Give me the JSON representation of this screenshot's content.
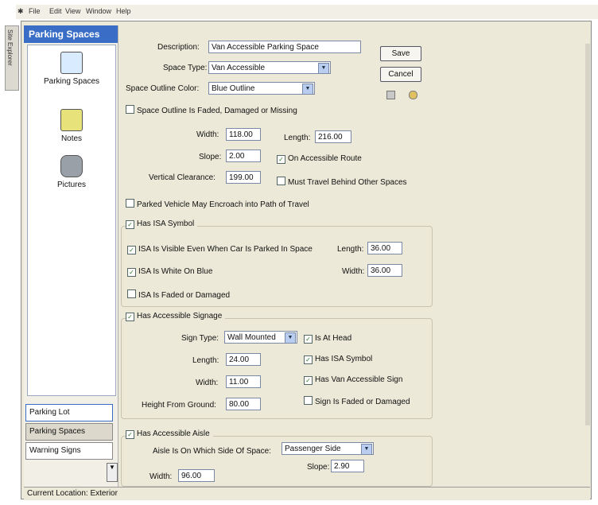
{
  "menubar": {
    "items": [
      "File",
      "Edit",
      "View",
      "Window",
      "Help"
    ]
  },
  "side_tab": "Site Explorer",
  "left": {
    "header": "Parking Spaces",
    "nav": [
      {
        "label": "Parking Spaces",
        "icon": "document-edit-icon"
      },
      {
        "label": "Notes",
        "icon": "notes-icon"
      },
      {
        "label": "Pictures",
        "icon": "camera-icon"
      }
    ],
    "bottom_nav": [
      "Parking Lot",
      "Parking Spaces",
      "Warning Signs"
    ]
  },
  "status": "Current Location: Exterior",
  "form": {
    "description_label": "Description:",
    "description_value": "Van Accessible Parking Space",
    "space_type_label": "Space Type:",
    "space_type_value": "Van Accessible",
    "outline_color_label": "Space Outline Color:",
    "outline_color_value": "Blue Outline",
    "outline_faded": "Space Outline Is Faded, Damaged or Missing",
    "width_label": "Width:",
    "width_value": "118.00",
    "length_label": "Length:",
    "length_value": "216.00",
    "slope_label": "Slope:",
    "slope_value": "2.00",
    "on_route": "On Accessible Route",
    "clearance_label": "Vertical Clearance:",
    "clearance_value": "199.00",
    "travel_behind": "Must Travel Behind Other Spaces",
    "encroach": "Parked Vehicle May Encroach into Path of Travel",
    "save": "Save",
    "cancel": "Cancel"
  },
  "isa": {
    "has_isa": "Has ISA Symbol",
    "visible": "ISA Is Visible Even When Car Is Parked In Space",
    "length_label": "Length:",
    "length_value": "36.00",
    "white_blue": "ISA Is White On Blue",
    "width_label": "Width:",
    "width_value": "36.00",
    "faded": "ISA Is Faded or Damaged"
  },
  "signage": {
    "has_signage": "Has Accessible Signage",
    "sign_type_label": "Sign Type:",
    "sign_type_value": "Wall Mounted",
    "at_head": "Is At Head",
    "length_label": "Length:",
    "length_value": "24.00",
    "has_isa": "Has ISA Symbol",
    "width_label": "Width:",
    "width_value": "11.00",
    "van_sign": "Has Van Accessible Sign",
    "height_label": "Height From Ground:",
    "height_value": "80.00",
    "sign_faded": "Sign Is Faded or Damaged"
  },
  "aisle": {
    "has_aisle": "Has Accessible Aisle",
    "side_label": "Aisle Is On Which Side Of Space:",
    "side_value": "Passenger Side",
    "width_label": "Width:",
    "width_value": "96.00",
    "slope_label": "Slope:",
    "slope_value": "2.90"
  },
  "checked": {
    "outline_faded": false,
    "on_route": true,
    "travel_behind": false,
    "encroach": false,
    "has_isa": true,
    "isa_visible": true,
    "isa_white_blue": true,
    "isa_faded": false,
    "has_signage": true,
    "at_head": true,
    "sign_has_isa": true,
    "van_sign": true,
    "sign_faded": false,
    "has_aisle": true
  },
  "colors": {
    "header_blue": "#3a6ec6",
    "panel": "#ece9d8",
    "check": "#2a7a2a"
  }
}
